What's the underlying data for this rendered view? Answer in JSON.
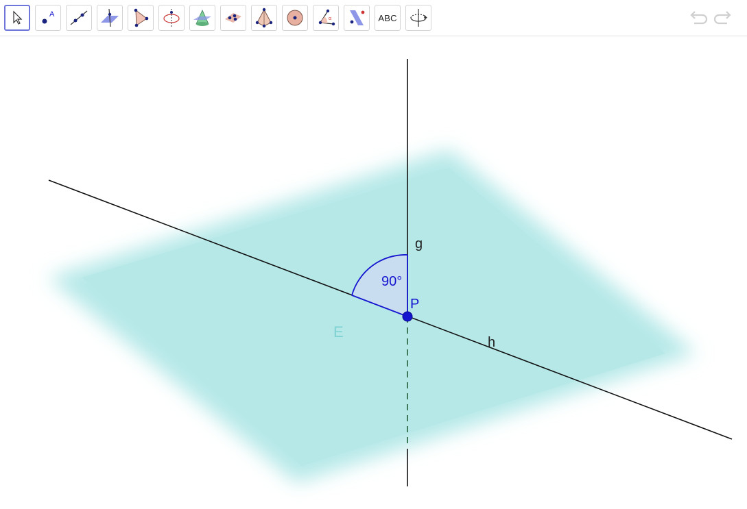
{
  "toolbar": {
    "tools": [
      {
        "name": "Move"
      },
      {
        "name": "Point",
        "icon_label": "A"
      },
      {
        "name": "Line"
      },
      {
        "name": "Perpendicular Line"
      },
      {
        "name": "Polygon"
      },
      {
        "name": "Circle with Axis"
      },
      {
        "name": "Intersect Two Surfaces"
      },
      {
        "name": "Plane through 3 Points"
      },
      {
        "name": "Pyramid"
      },
      {
        "name": "Sphere"
      },
      {
        "name": "Angle"
      },
      {
        "name": "Reflect about Plane"
      },
      {
        "name": "Text",
        "icon_label": "ABC"
      },
      {
        "name": "Rotate 3D Graphics View"
      }
    ],
    "undo_icon": "undo-icon",
    "redo_icon": "redo-icon"
  },
  "scene": {
    "line_g_label": "g",
    "line_h_label": "h",
    "plane_label": "E",
    "point_label": "P",
    "angle_label": "90°",
    "colors": {
      "plane": "#b6e8e8",
      "point": "#1515cf",
      "angle_fill": "#c9ddf0",
      "angle_stroke": "#1515cf",
      "hidden_line": "#3d7a5a"
    }
  }
}
